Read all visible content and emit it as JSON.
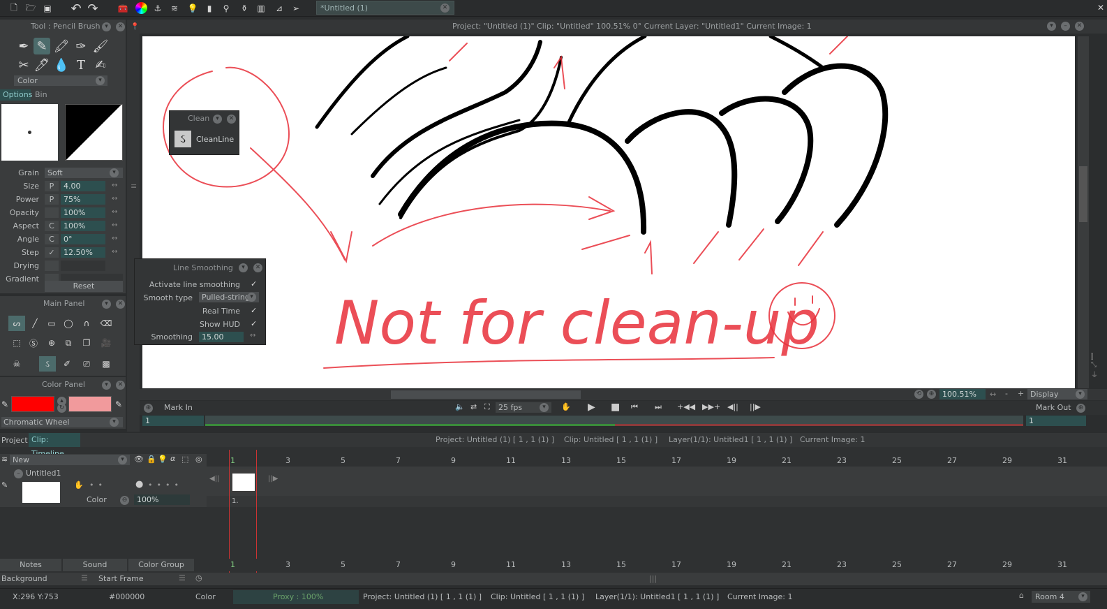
{
  "toolbar": {
    "tab_title": "*Untitled (1)",
    "project_info": "Project:  \"Untitled (1)\"  Clip: \"Untitled\"   100.51%   0°  Current Layer: \"Untitled1\"  Current Image: 1"
  },
  "tool_panel": {
    "title": "Tool : Pencil Brush",
    "color_select": "Color",
    "tabs": [
      "Options",
      "Bin"
    ],
    "params": [
      {
        "label": "Grain",
        "value": "Soft"
      },
      {
        "label": "Size",
        "flag": "P",
        "value": "4.00"
      },
      {
        "label": "Power",
        "flag": "P",
        "value": "75%"
      },
      {
        "label": "Opacity",
        "flag": "",
        "value": "100%"
      },
      {
        "label": "Aspect",
        "flag": "C",
        "value": "100%"
      },
      {
        "label": "Angle",
        "flag": "C",
        "value": "0°"
      },
      {
        "label": "Step",
        "flag": "✓",
        "value": "12.50%"
      },
      {
        "label": "Drying",
        "flag": "",
        "value": ""
      },
      {
        "label": "Gradient",
        "flag": "",
        "value": ""
      }
    ],
    "reset": "Reset"
  },
  "main_panel": {
    "title": "Main Panel"
  },
  "color_panel": {
    "title": "Color Panel",
    "primary_color": "#ff0000",
    "secondary_color": "#f19a9c",
    "wheel_select": "Chromatic Wheel"
  },
  "clean_popup": {
    "title": "Clean",
    "item": "CleanLine"
  },
  "line_smoothing": {
    "title": "Line Smoothing",
    "activate": "Activate line smoothing",
    "smooth_type_label": "Smooth type",
    "smooth_type_value": "Pulled-string",
    "real_time": "Real Time",
    "show_hud": "Show HUD",
    "smoothing_label": "Smoothing",
    "smoothing_value": "15.00"
  },
  "canvas": {
    "note_text": "Not for clean-up",
    "zoom": "100.51%",
    "display": "Display"
  },
  "transport": {
    "mark_in": "Mark In",
    "mark_out": "Mark Out",
    "fps": "25 fps",
    "in_value": "1",
    "out_value": "1"
  },
  "timeline": {
    "tabs": [
      "Project",
      "Clip: Timeline"
    ],
    "info": [
      "Project: Untitled (1) [ 1 , 1  (1) ]",
      "Clip: Untitled [ 1 , 1  (1) ]",
      "Layer(1/1): Untitled1 [ 1 , 1  (1) ]",
      "Current Image: 1"
    ],
    "new_label": "New",
    "layer_name": "Untitled1",
    "layer_color": "Color",
    "layer_opacity": "100%",
    "frame_label": "1.",
    "ticks": [
      "1",
      "3",
      "5",
      "7",
      "9",
      "11",
      "13",
      "15",
      "17",
      "19",
      "21",
      "23",
      "25",
      "27",
      "29",
      "31"
    ],
    "bottom_buttons": [
      "Notes",
      "Sound",
      "Color Group"
    ],
    "background": "Background",
    "start_frame": "Start Frame"
  },
  "status_bar": {
    "coords": "X:296  Y:753",
    "hex": "#000000",
    "color": "Color",
    "proxy": "Proxy : 100%",
    "project": "Project: Untitled (1) [ 1 , 1  (1) ]",
    "clip": "Clip: Untitled [ 1 , 1  (1) ]",
    "layer": "Layer(1/1): Untitled1 [ 1 , 1  (1) ]",
    "current_image": "Current Image: 1",
    "room": "Room 4"
  }
}
